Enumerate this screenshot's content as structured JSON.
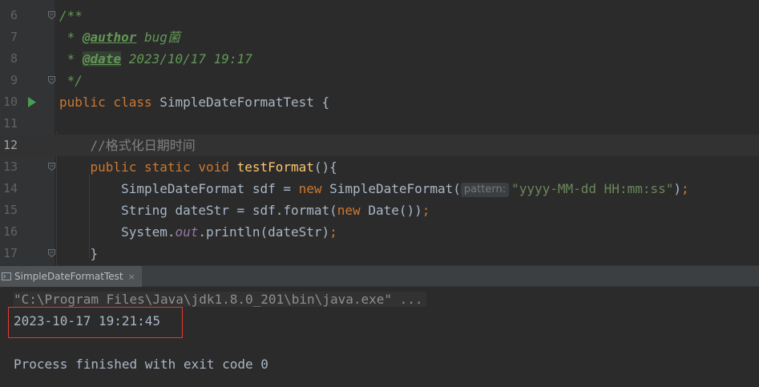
{
  "editor": {
    "lines": [
      {
        "num": "6",
        "segments": [
          {
            "cls": "cmt",
            "t": "/**"
          }
        ]
      },
      {
        "num": "7",
        "segments": [
          {
            "cls": "cmt",
            "t": " * "
          },
          {
            "cls": "tag",
            "t": "@author"
          },
          {
            "cls": "cmt",
            "t": " bug菌"
          }
        ]
      },
      {
        "num": "8",
        "segments": [
          {
            "cls": "cmt",
            "t": " * "
          },
          {
            "cls": "tag tag-hl",
            "t": "@date"
          },
          {
            "cls": "cmt",
            "t": " 2023/10/17 19:17"
          }
        ]
      },
      {
        "num": "9",
        "segments": [
          {
            "cls": "cmt",
            "t": " */"
          }
        ]
      },
      {
        "num": "10",
        "segments": [
          {
            "cls": "kw",
            "t": "public class "
          },
          {
            "cls": "",
            "t": "SimpleDateFormatTest {"
          }
        ]
      },
      {
        "num": "11",
        "segments": []
      },
      {
        "num": "12",
        "segments": [
          {
            "cls": "",
            "t": "    "
          },
          {
            "cls": "lcmt",
            "t": "//格式化日期时间"
          }
        ]
      },
      {
        "num": "13",
        "segments": [
          {
            "cls": "",
            "t": "    "
          },
          {
            "cls": "kw",
            "t": "public static void "
          },
          {
            "cls": "fn",
            "t": "testFormat"
          },
          {
            "cls": "",
            "t": "(){"
          }
        ]
      },
      {
        "num": "14",
        "segments": [
          {
            "cls": "",
            "t": "        SimpleDateFormat sdf = "
          },
          {
            "cls": "kw",
            "t": "new "
          },
          {
            "cls": "",
            "t": "SimpleDateFormat("
          },
          {
            "cls": "hint",
            "t": "pattern:"
          },
          {
            "cls": "str",
            "t": "\"yyyy-MM-dd HH:mm:ss\""
          },
          {
            "cls": "",
            "t": ")"
          },
          {
            "cls": "kw",
            "t": ";"
          }
        ]
      },
      {
        "num": "15",
        "segments": [
          {
            "cls": "",
            "t": "        String dateStr = sdf.format("
          },
          {
            "cls": "kw",
            "t": "new "
          },
          {
            "cls": "",
            "t": "Date())"
          },
          {
            "cls": "kw",
            "t": ";"
          }
        ]
      },
      {
        "num": "16",
        "segments": [
          {
            "cls": "",
            "t": "        System."
          },
          {
            "cls": "static-field",
            "t": "out"
          },
          {
            "cls": "",
            "t": ".println(dateStr)"
          },
          {
            "cls": "kw",
            "t": ";"
          }
        ]
      },
      {
        "num": "17",
        "segments": [
          {
            "cls": "",
            "t": "    }"
          }
        ]
      }
    ],
    "current_line": "12",
    "run_gutter_line": "10",
    "fold_lines": [
      "6",
      "9",
      "13",
      "17"
    ]
  },
  "run_panel": {
    "tab_label": "SimpleDateFormatTest",
    "tab_close": "×",
    "console_lines": [
      "\"C:\\Program Files\\Java\\jdk1.8.0_201\\bin\\java.exe\" ...",
      "2023-10-17 19:21:45",
      "",
      "Process finished with exit code 0"
    ]
  },
  "colors": {
    "editor_bg": "#2b2b2b",
    "keyword": "#cc7832",
    "doc_comment": "#629755",
    "string": "#6a8759",
    "function": "#ffc66d",
    "highlight_box": "#e53935"
  }
}
